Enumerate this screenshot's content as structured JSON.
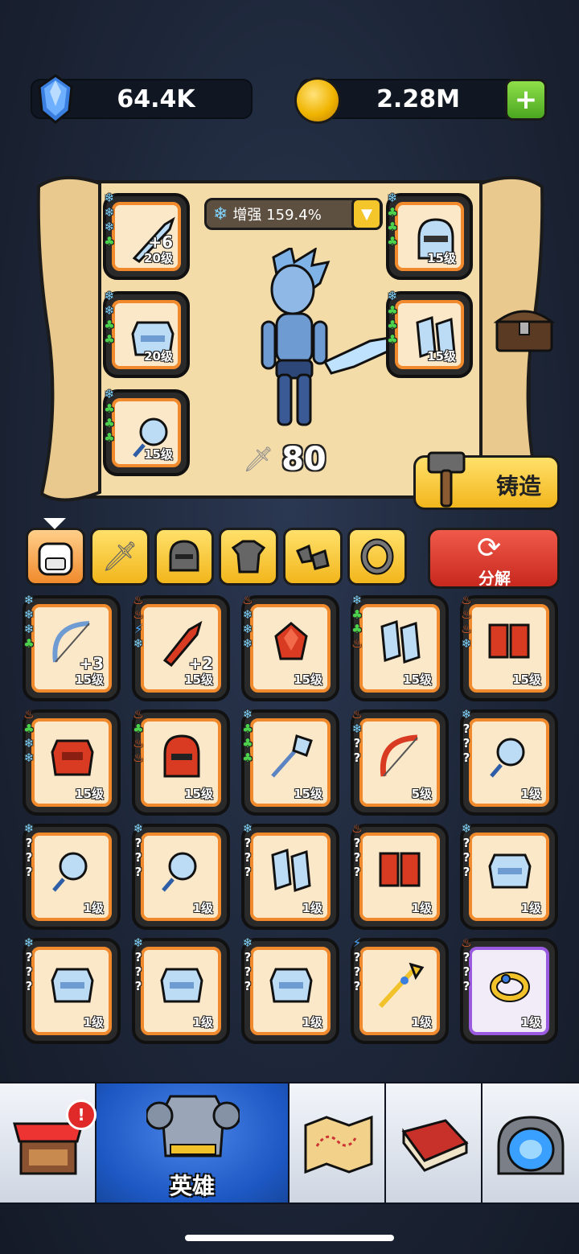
{
  "resources": {
    "gems": "64.4K",
    "coins": "2.28M",
    "add_icon": "plus-icon"
  },
  "hero_panel": {
    "enhance_label": "增强 159.4%",
    "power": "80",
    "forge_label": "铸造",
    "equipped": [
      {
        "item": "ice-sword",
        "level": "20级",
        "plus": "+6",
        "tags": [
          "❄",
          "❄",
          "❄",
          "♣"
        ]
      },
      {
        "item": "ice-armor",
        "level": "20级",
        "plus": "",
        "tags": [
          "❄",
          "❄",
          "♣",
          "♣"
        ]
      },
      {
        "item": "ice-rose",
        "level": "15级",
        "plus": "",
        "tags": [
          "❄",
          "♣",
          "♣",
          "♣"
        ]
      },
      {
        "item": "ice-helmet",
        "level": "15级",
        "plus": "",
        "tags": [
          "❄",
          "♣",
          "♣",
          "♣"
        ]
      },
      {
        "item": "ice-boots",
        "level": "15级",
        "plus": "",
        "tags": [
          "❄",
          "♣",
          "♣",
          "♣"
        ]
      }
    ]
  },
  "filter_tabs": [
    "all",
    "weapon",
    "helmet",
    "armor",
    "boots",
    "ring"
  ],
  "dismantle_label": "分解",
  "inventory": [
    {
      "item": "ice-bow",
      "level": "15级",
      "plus": "+3",
      "tags": [
        "❄",
        "❄",
        "❄",
        "♣"
      ],
      "color": "ice"
    },
    {
      "item": "fire-sword",
      "level": "15级",
      "plus": "+2",
      "tags": [
        "♨",
        "♨",
        "⚡",
        "❄"
      ],
      "color": "fire"
    },
    {
      "item": "fire-crystal",
      "level": "15级",
      "plus": "",
      "tags": [
        "♨",
        "❄",
        "❄",
        "❄"
      ],
      "color": "fire"
    },
    {
      "item": "ice-boots",
      "level": "15级",
      "plus": "",
      "tags": [
        "❄",
        "♣",
        "♣",
        "♨"
      ],
      "color": "ice"
    },
    {
      "item": "fire-boots",
      "level": "15级",
      "plus": "",
      "tags": [
        "♨",
        "♨",
        "♨",
        "❄"
      ],
      "color": "fire"
    },
    {
      "item": "fire-armor",
      "level": "15级",
      "plus": "",
      "tags": [
        "♨",
        "♣",
        "❄",
        "❄"
      ],
      "color": "fire"
    },
    {
      "item": "fire-helmet",
      "level": "15级",
      "plus": "",
      "tags": [
        "♨",
        "♣",
        "♨",
        "♨"
      ],
      "color": "fire"
    },
    {
      "item": "ice-staff",
      "level": "15级",
      "plus": "",
      "tags": [
        "❄",
        "♣",
        "♣",
        "♣"
      ],
      "color": "ice"
    },
    {
      "item": "fire-bow",
      "level": "5级",
      "plus": "",
      "tags": [
        "♨",
        "❄",
        "?",
        "?"
      ],
      "color": "fire"
    },
    {
      "item": "ice-rose",
      "level": "1级",
      "plus": "",
      "tags": [
        "❄",
        "?",
        "?",
        "?"
      ],
      "color": "ice"
    },
    {
      "item": "ice-rose",
      "level": "1级",
      "plus": "",
      "tags": [
        "❄",
        "?",
        "?",
        "?"
      ],
      "color": "ice"
    },
    {
      "item": "ice-rose",
      "level": "1级",
      "plus": "",
      "tags": [
        "❄",
        "?",
        "?",
        "?"
      ],
      "color": "ice"
    },
    {
      "item": "ice-boots",
      "level": "1级",
      "plus": "",
      "tags": [
        "❄",
        "?",
        "?",
        "?"
      ],
      "color": "ice"
    },
    {
      "item": "fire-boots",
      "level": "1级",
      "plus": "",
      "tags": [
        "♨",
        "?",
        "?",
        "?"
      ],
      "color": "fire"
    },
    {
      "item": "ice-armor",
      "level": "1级",
      "plus": "",
      "tags": [
        "❄",
        "?",
        "?",
        "?"
      ],
      "color": "ice"
    },
    {
      "item": "ice-armor",
      "level": "1级",
      "plus": "",
      "tags": [
        "❄",
        "?",
        "?",
        "?"
      ],
      "color": "ice"
    },
    {
      "item": "ice-armor",
      "level": "1级",
      "plus": "",
      "tags": [
        "❄",
        "?",
        "?",
        "?"
      ],
      "color": "ice"
    },
    {
      "item": "ice-armor",
      "level": "1级",
      "plus": "",
      "tags": [
        "❄",
        "?",
        "?",
        "?"
      ],
      "color": "ice"
    },
    {
      "item": "golden-spear",
      "level": "1级",
      "plus": "",
      "tags": [
        "⚡",
        "?",
        "?",
        "?"
      ],
      "color": "gold"
    },
    {
      "item": "gold-ring",
      "level": "1级",
      "plus": "",
      "tags": [
        "♨",
        "?",
        "?",
        "?"
      ],
      "color": "gold",
      "rarity": "purple"
    }
  ],
  "bottom_nav": [
    {
      "name": "shop",
      "label": "",
      "badge": "!"
    },
    {
      "name": "hero",
      "label": "英雄",
      "active": true
    },
    {
      "name": "map",
      "label": ""
    },
    {
      "name": "book",
      "label": ""
    },
    {
      "name": "portal",
      "label": ""
    }
  ]
}
